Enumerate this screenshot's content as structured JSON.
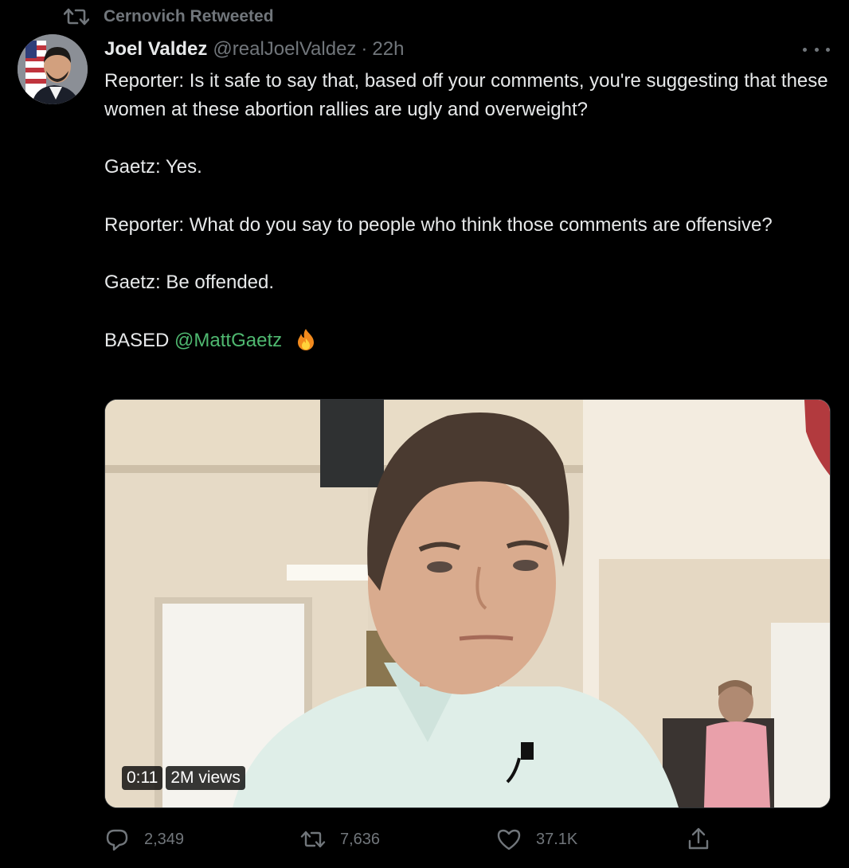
{
  "retweet_context": {
    "label": "Cernovich Retweeted",
    "icon": "retweet-icon"
  },
  "tweet": {
    "author": {
      "display_name": "Joel Valdez",
      "handle": "@realJoelValdez",
      "separator": "·",
      "time": "22h"
    },
    "body": {
      "para1": "Reporter: Is it safe to say that, based off your comments, you're suggesting that these women at these abortion rallies are ugly and overweight?",
      "para2": "Gaetz: Yes.",
      "para3": "Reporter: What do you say to people who think those comments are offensive?",
      "para4": "Gaetz: Be offended.",
      "closing_prefix": "BASED",
      "mention": "@MattGaetz",
      "emoji": "fire"
    },
    "media": {
      "type": "video",
      "duration": "0:11",
      "views": "2M views"
    },
    "actions": {
      "replies": "2,349",
      "retweets": "7,636",
      "likes": "37.1K"
    }
  },
  "colors": {
    "background": "#000000",
    "text": "#e7e9ea",
    "muted": "#71767b",
    "mention": "#4fb870"
  }
}
